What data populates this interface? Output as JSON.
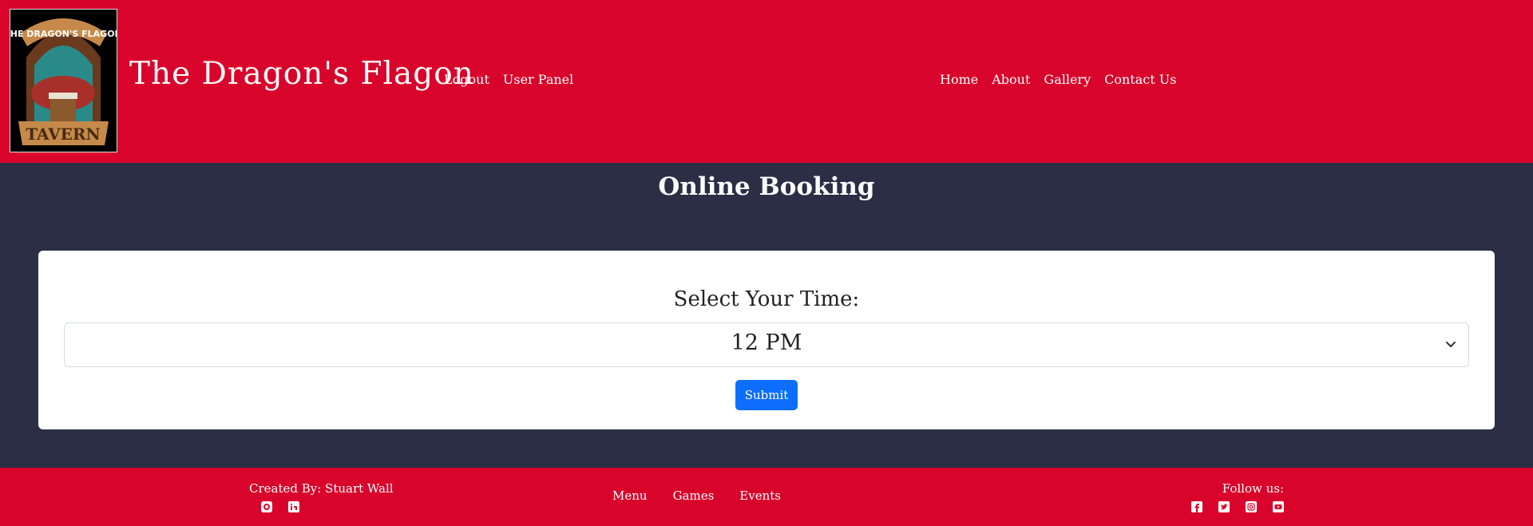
{
  "header": {
    "brand": "The Dragon's Flagon",
    "logo_text_top": "THE DRAGON'S FLAGON",
    "logo_text_bottom": "TAVERN",
    "nav_left": [
      "Logout",
      "User Panel"
    ],
    "nav_center": [
      "Home",
      "About",
      "Gallery",
      "Contact Us"
    ]
  },
  "main": {
    "title": "Online Booking",
    "form": {
      "label": "Select Your Time:",
      "selected_time": "12 PM",
      "submit_label": "Submit"
    }
  },
  "footer": {
    "credit": "Created By: Stuart Wall",
    "credit_icons": [
      "github-icon",
      "linkedin-icon"
    ],
    "nav": [
      "Menu",
      "Games",
      "Events"
    ],
    "follow_label": "Follow us:",
    "social_icons": [
      "facebook-icon",
      "twitter-icon",
      "instagram-icon",
      "youtube-icon"
    ]
  },
  "colors": {
    "brand_red": "#d9042b",
    "background": "#2b2e44",
    "primary_button": "#0d6efd"
  }
}
